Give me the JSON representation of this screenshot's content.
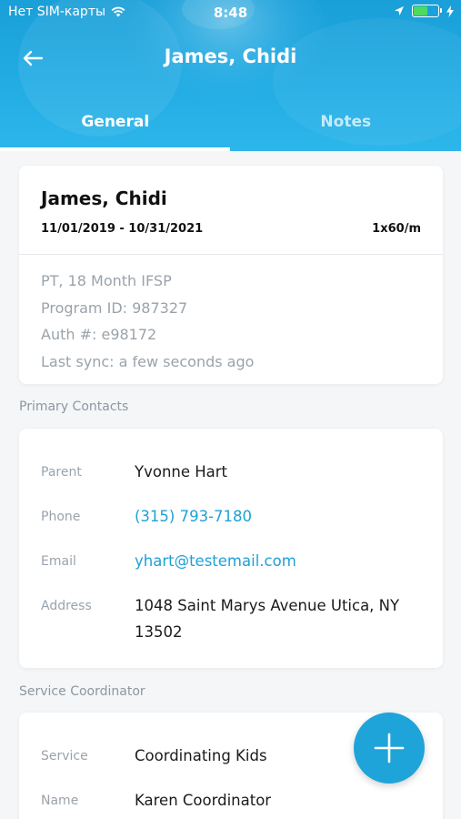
{
  "status_bar": {
    "carrier": "Нет SIM-карты",
    "time": "8:48",
    "wifi_icon": "wifi-icon",
    "location_icon": "location-arrow-icon",
    "battery_icon": "battery-icon",
    "charging_icon": "bolt-icon"
  },
  "header": {
    "title": "James, Chidi",
    "back_icon": "arrow-left-icon"
  },
  "tabs": [
    {
      "label": "General",
      "active": true
    },
    {
      "label": "Notes",
      "active": false
    }
  ],
  "summary": {
    "name": "James, Chidi",
    "dates": "11/01/2019 - 10/31/2021",
    "frequency": "1x60/m",
    "lines": [
      "PT, 18 Month IFSP",
      "Program ID: 987327",
      "Auth #: e98172",
      "Last sync: a few seconds ago"
    ]
  },
  "primary_contacts": {
    "section_label": "Primary Contacts",
    "parent_label": "Parent",
    "parent_value": "Yvonne Hart",
    "phone_label": "Phone",
    "phone_value": "(315) 793-7180",
    "email_label": "Email",
    "email_value": "yhart@testemail.com",
    "address_label": "Address",
    "address_line1": "1048  Saint Marys Avenue Utica, NY",
    "address_line2": "13502"
  },
  "service_coordinator": {
    "section_label": "Service Coordinator",
    "service_label": "Service",
    "service_value": "Coordinating Kids",
    "name_label": "Name",
    "name_value": "Karen Coordinator"
  },
  "fab": {
    "icon": "plus-icon"
  },
  "colors": {
    "accent": "#1fa4d9",
    "link": "#1ea1d6",
    "background": "#f4f6f8"
  }
}
